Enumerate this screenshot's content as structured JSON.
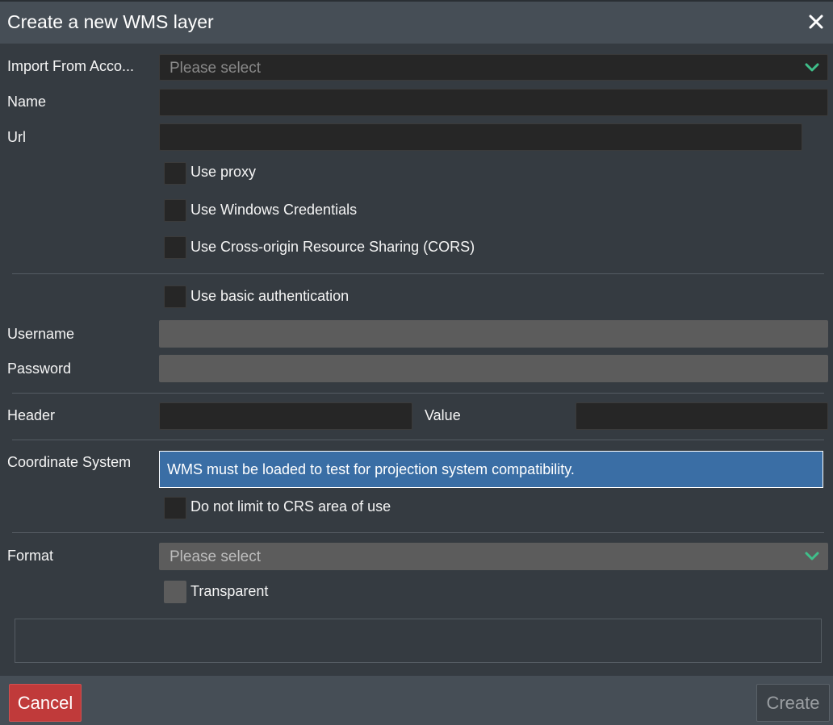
{
  "dialog": {
    "title": "Create a new WMS layer",
    "close_icon": "close-icon"
  },
  "import_from_account": {
    "label": "Import From Acco...",
    "placeholder": "Please select",
    "chevron_icon": "chevron-down-icon"
  },
  "name": {
    "label": "Name",
    "value": ""
  },
  "url": {
    "label": "Url",
    "value": ""
  },
  "options": {
    "use_proxy": "Use proxy",
    "use_windows_credentials": "Use Windows Credentials",
    "use_cors": "Use Cross-origin Resource Sharing (CORS)"
  },
  "auth": {
    "use_basic_auth": "Use basic authentication",
    "username_label": "Username",
    "password_label": "Password"
  },
  "header": {
    "label": "Header",
    "value_label": "Value"
  },
  "coordinate_system": {
    "label": "Coordinate System",
    "message": "WMS must be loaded to test for projection system compatibility.",
    "do_not_limit": "Do not limit to CRS area of use"
  },
  "format": {
    "label": "Format",
    "placeholder": "Please select",
    "transparent": "Transparent"
  },
  "footer": {
    "cancel": "Cancel",
    "create": "Create"
  },
  "colors": {
    "accent_green": "#3fbf8a",
    "info_blue": "#3a6ea5",
    "cancel_red": "#c03a3a"
  }
}
